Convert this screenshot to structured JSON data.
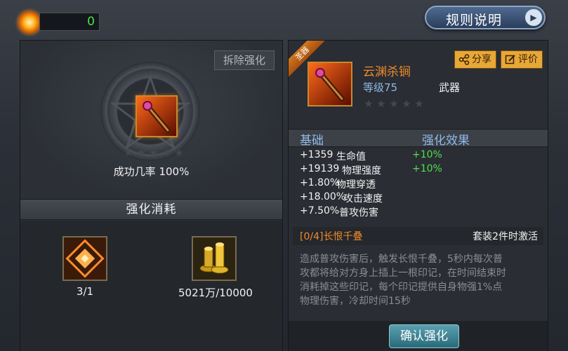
{
  "currency": {
    "value": "0",
    "icon": "gold-orb-icon"
  },
  "rules_button": {
    "label": "规则说明"
  },
  "left": {
    "remove_button": "拆除强化",
    "success_rate_text": "成功几率 100%",
    "stars_total": 5,
    "cost_header": "强化消耗",
    "cost_items": [
      {
        "icon": "enhance-stone-icon",
        "label": "3/1"
      },
      {
        "icon": "gold-coins-icon",
        "label": "5021万/10000"
      }
    ]
  },
  "right": {
    "ribbon_text": "圣器",
    "item": {
      "name": "云渊杀锏",
      "level": "等级75",
      "type": "武器",
      "stars_total": 5,
      "icon": "mace-weapon-icon"
    },
    "share_button": "分享",
    "review_button": "评价",
    "stats_header_base": "基础",
    "stats_header_enhance": "强化效果",
    "stats": [
      {
        "value": "+1359",
        "name": "生命值",
        "enhance": "+10%"
      },
      {
        "value": "+19139",
        "name": "物理强度",
        "enhance": "+10%"
      },
      {
        "value": "+1.80%",
        "name": "物理穿透",
        "enhance": ""
      },
      {
        "value": "+18.00%",
        "name": "攻击速度",
        "enhance": ""
      },
      {
        "value": "+7.50%",
        "name": "普攻伤害",
        "enhance": ""
      }
    ],
    "set_name": "[0/4]长恨千叠",
    "set_condition": "套装2件时激活",
    "set_description_lines": [
      "造成普攻伤害后，触发长恨千叠，5秒内每次普",
      "攻都将给对方身上插上一根印记，在时间结束时",
      "消耗掉这些印记，每个印记提供自身物强1%点",
      "物理伤害，冷却时间15秒"
    ],
    "confirm_button": "确认强化"
  },
  "colors": {
    "accent_orange": "#f08a2a",
    "stat_green": "#4fe04a",
    "label_blue": "#8fb8e8"
  }
}
